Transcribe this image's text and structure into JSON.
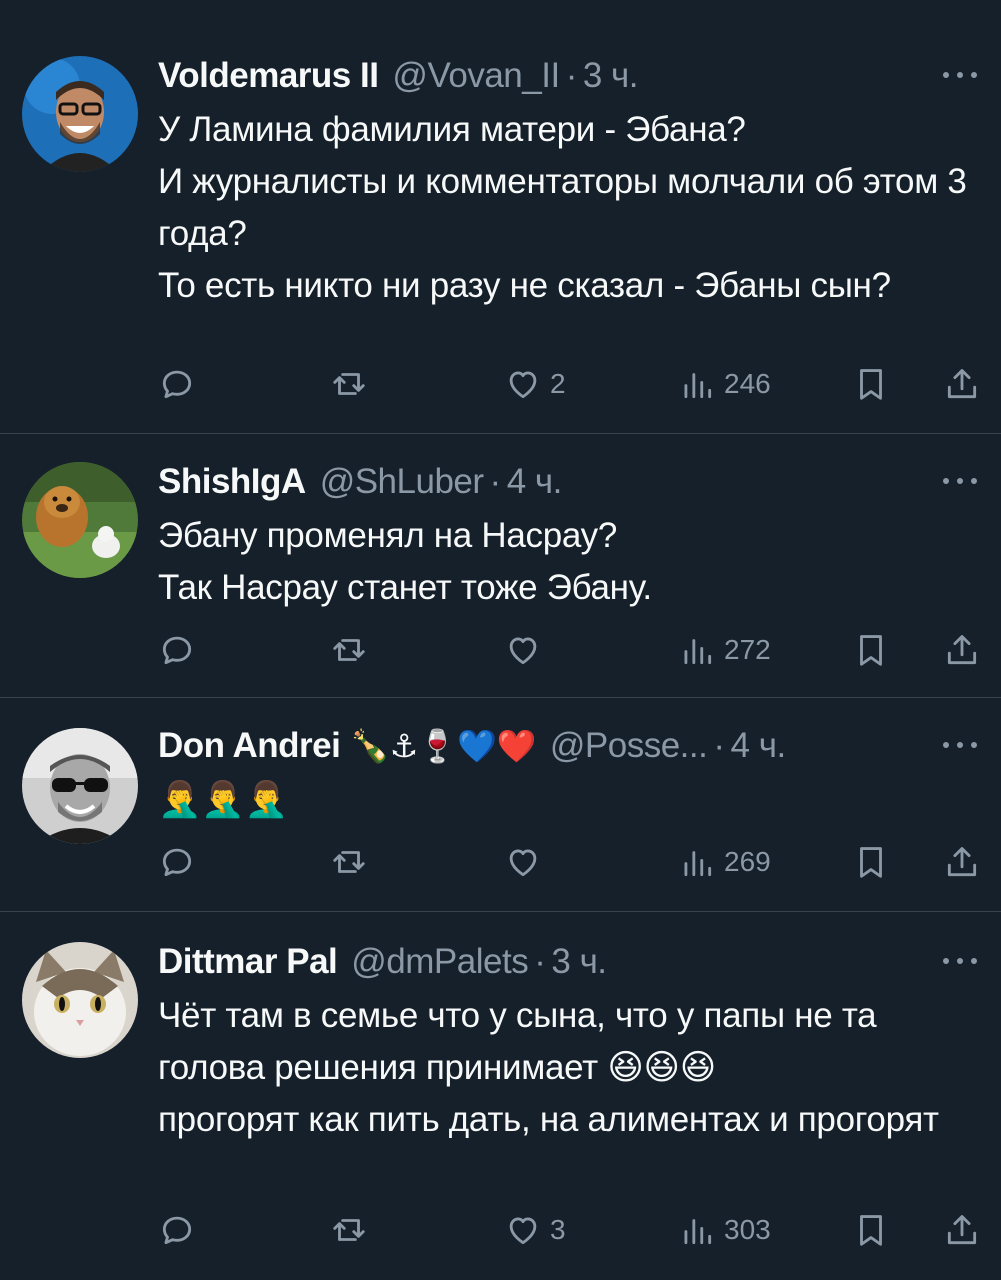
{
  "tweets": [
    {
      "name": "Voldemarus II",
      "badges": "",
      "handle": "@Vovan_II",
      "time": "3 ч.",
      "text": "У Ламина фамилия матери - Эбана?\nИ журналисты и комментаторы молчали об этом 3 года?\nТо есть никто ни разу не сказал - Эбаны сын?",
      "replies": "",
      "retweets": "",
      "likes": "2",
      "views": "246"
    },
    {
      "name": "ShishIgA",
      "badges": "",
      "handle": "@ShLuber",
      "time": "4 ч.",
      "text": "Эбану променял на Насрау?\nТак Насрау станет тоже Эбану.",
      "replies": "",
      "retweets": "",
      "likes": "",
      "views": "272"
    },
    {
      "name": "Don Andrei",
      "badges": "🍾⚓🍷💙❤️",
      "handle": "@Posse...",
      "time": "4 ч.",
      "text": "🤦‍♂️🤦‍♂️🤦‍♂️",
      "replies": "",
      "retweets": "",
      "likes": "",
      "views": "269"
    },
    {
      "name": "Dittmar Pal",
      "badges": "",
      "handle": "@dmPalets",
      "time": "3 ч.",
      "text": "Чёт там в семье что у сына, что у папы не та голова решения принимает 😆😆😆\nпрогорят как пить дать, на алиментах и прогорят",
      "replies": "",
      "retweets": "",
      "likes": "3",
      "views": "303"
    }
  ],
  "icons": {
    "reply": "reply-icon",
    "retweet": "retweet-icon",
    "like": "heart-icon",
    "views": "views-icon",
    "bookmark": "bookmark-icon",
    "share": "share-icon",
    "more": "more-icon"
  },
  "colors": {
    "background": "#15202b",
    "text": "#f7f9f9",
    "secondary": "#8b98a5",
    "divider": "#38444d"
  }
}
